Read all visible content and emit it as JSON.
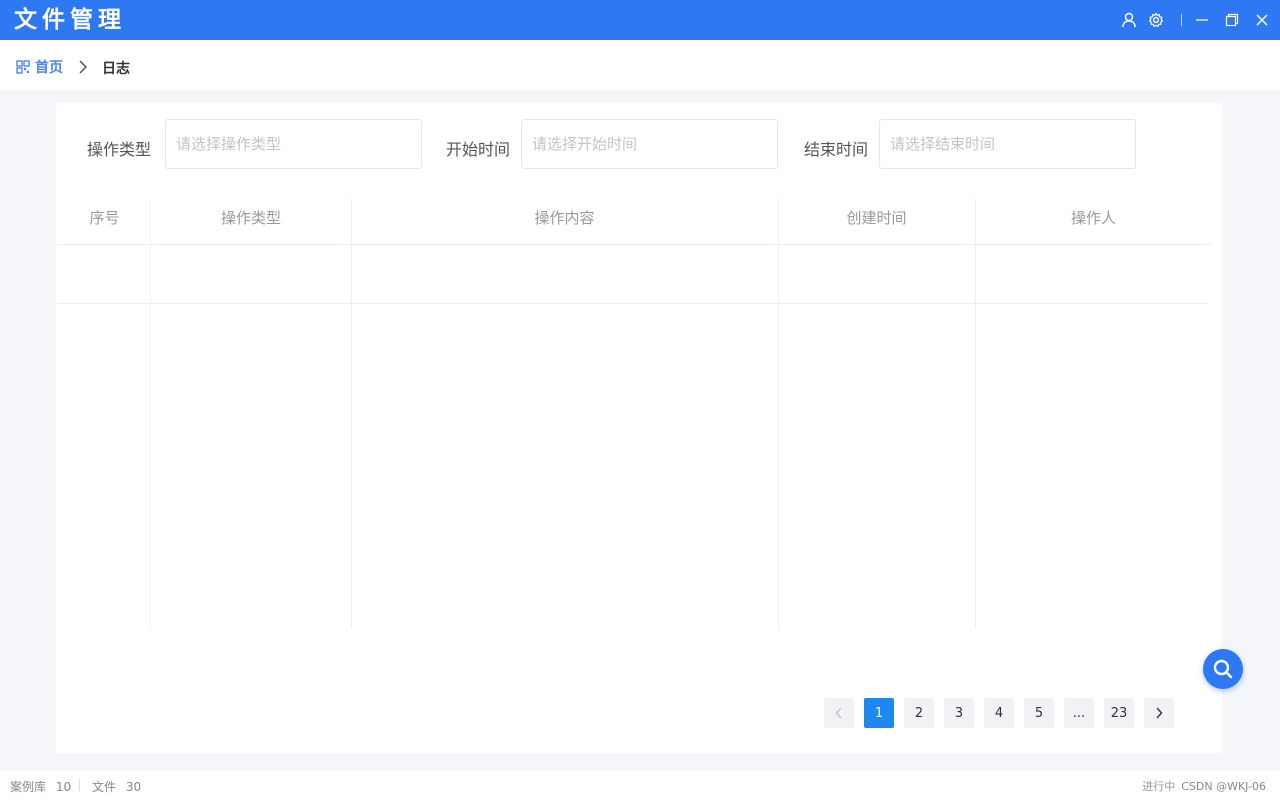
{
  "app": {
    "title": "文件管理",
    "accent_color": "#2f78f4"
  },
  "titlebar": {
    "icons": [
      "user-icon",
      "gear-icon",
      "minimize-icon",
      "maximize-icon",
      "close-icon"
    ]
  },
  "breadcrumb": {
    "home_label": "首页",
    "current_label": "日志"
  },
  "filters": {
    "operation_type": {
      "label": "操作类型",
      "placeholder": "请选择操作类型",
      "value": ""
    },
    "start_time": {
      "label": "开始时间",
      "placeholder": "请选择开始时间",
      "value": ""
    },
    "end_time": {
      "label": "结束时间",
      "placeholder": "请选择结束时间",
      "value": ""
    }
  },
  "table": {
    "columns": [
      "序号",
      "操作类型",
      "操作内容",
      "创建时间",
      "操作人"
    ],
    "rows": []
  },
  "pagination": {
    "current_page": "1",
    "pages": [
      "1",
      "2",
      "3",
      "4",
      "5",
      "...",
      "23"
    ]
  },
  "statusbar": {
    "case_library_label": "案例库",
    "case_library_count": "10",
    "files_label": "文件",
    "files_count": "30",
    "right_text": "进行中",
    "watermark": "CSDN @WKJ-06"
  }
}
